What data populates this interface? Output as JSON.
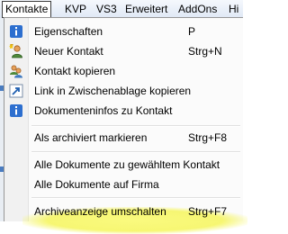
{
  "menubar": {
    "items": [
      "Kontakte",
      "KVP",
      "VS3",
      "Erweitert",
      "AddOns",
      "Hi"
    ]
  },
  "menu": {
    "items": [
      {
        "label": "Eigenschaften",
        "shortcut": "P",
        "icon": "info-icon"
      },
      {
        "label": "Neuer Kontakt",
        "shortcut": "Strg+N",
        "icon": "new-contact-icon"
      },
      {
        "label": "Kontakt kopieren",
        "shortcut": "",
        "icon": "copy-contact-icon"
      },
      {
        "label": "Link in Zwischenablage kopieren",
        "shortcut": "",
        "icon": "link-icon"
      },
      {
        "label": "Dokumenteninfos zu Kontakt",
        "shortcut": "",
        "icon": "info-icon"
      },
      {
        "label": "Als archiviert markieren",
        "shortcut": "Strg+F8",
        "icon": ""
      },
      {
        "label": "Alle Dokumente zu gewähltem Kontakt",
        "shortcut": "",
        "icon": ""
      },
      {
        "label": "Alle Dokumente auf Firma",
        "shortcut": "",
        "icon": ""
      },
      {
        "label": "Archiveanzeige umschalten",
        "shortcut": "Strg+F7",
        "icon": ""
      }
    ]
  },
  "colors": {
    "highlight": "#f5f55a",
    "info_icon": "#2d6fcf",
    "gutter": "#f1f1f1"
  }
}
